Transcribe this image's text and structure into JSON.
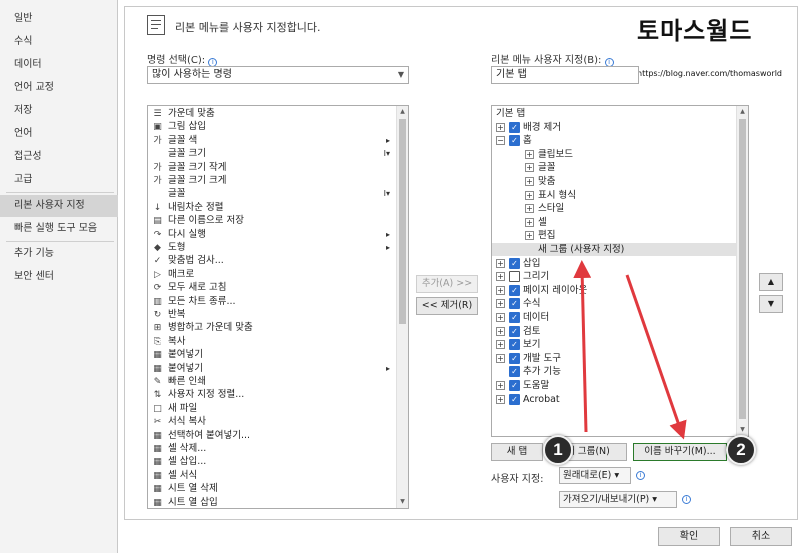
{
  "nav": {
    "items": [
      {
        "label": "일반"
      },
      {
        "label": "수식"
      },
      {
        "label": "데이터"
      },
      {
        "label": "언어 교정"
      },
      {
        "label": "저장"
      },
      {
        "label": "언어"
      },
      {
        "label": "접근성"
      },
      {
        "label": "고급"
      },
      {
        "label": "리본 사용자 지정"
      },
      {
        "label": "빠른 실행 도구 모음"
      },
      {
        "label": "추가 기능"
      },
      {
        "label": "보안 센터"
      }
    ],
    "selected": "리본 사용자 지정"
  },
  "header": {
    "title": "리본 메뉴를 사용자 지정합니다."
  },
  "watermark": {
    "title": "토마스월드",
    "url": "https://blog.naver.com/thomasworld"
  },
  "left": {
    "label": "명령 선택(C):",
    "combo_value": "많이 사용하는 명령",
    "commands": [
      {
        "icon": "☰",
        "label": "가운데 맞춤",
        "side": ""
      },
      {
        "icon": "▣",
        "label": "그림 삽입",
        "side": ""
      },
      {
        "icon": "가",
        "label": "글꼴 색",
        "side": "▸"
      },
      {
        "icon": "",
        "label": "글꼴 크기",
        "side": "I▾"
      },
      {
        "icon": "가",
        "label": "글꼴 크기 작게",
        "side": ""
      },
      {
        "icon": "가",
        "label": "글꼴 크기 크게",
        "side": ""
      },
      {
        "icon": "",
        "label": "글꼴",
        "side": "I▾"
      },
      {
        "icon": "↓",
        "label": "내림차순 정렬",
        "side": ""
      },
      {
        "icon": "▤",
        "label": "다른 이름으로 저장",
        "side": ""
      },
      {
        "icon": "↷",
        "label": "다시 실행",
        "side": "▸"
      },
      {
        "icon": "◆",
        "label": "도형",
        "side": "▸"
      },
      {
        "icon": "✓",
        "label": "맞춤법 검사...",
        "side": ""
      },
      {
        "icon": "▷",
        "label": "매크로",
        "side": ""
      },
      {
        "icon": "⟳",
        "label": "모두 새로 고침",
        "side": ""
      },
      {
        "icon": "▥",
        "label": "모든 차트 종류...",
        "side": ""
      },
      {
        "icon": "↻",
        "label": "반복",
        "side": ""
      },
      {
        "icon": "⊞",
        "label": "병합하고 가운데 맞춤",
        "side": ""
      },
      {
        "icon": "⎘",
        "label": "복사",
        "side": ""
      },
      {
        "icon": "▦",
        "label": "붙여넣기",
        "side": ""
      },
      {
        "icon": "▦",
        "label": "붙여넣기",
        "side": "▸"
      },
      {
        "icon": "✎",
        "label": "빠른 인쇄",
        "side": ""
      },
      {
        "icon": "⇅",
        "label": "사용자 지정 정렬...",
        "side": ""
      },
      {
        "icon": "□",
        "label": "새 파일",
        "side": ""
      },
      {
        "icon": "✂",
        "label": "서식 복사",
        "side": ""
      },
      {
        "icon": "▦",
        "label": "선택하여 붙여넣기...",
        "side": ""
      },
      {
        "icon": "▦",
        "label": "셀 삭제...",
        "side": ""
      },
      {
        "icon": "▦",
        "label": "셀 삽입...",
        "side": ""
      },
      {
        "icon": "▦",
        "label": "셀 서식",
        "side": ""
      },
      {
        "icon": "▦",
        "label": "시트 열 삭제",
        "side": ""
      },
      {
        "icon": "▦",
        "label": "시트 열 삽입",
        "side": ""
      }
    ]
  },
  "middle": {
    "add_button": "추가(A) >>",
    "remove_button": "<< 제거(R)"
  },
  "right": {
    "label": "리본 메뉴 사용자 지정(B):",
    "textbox_value": "기본 탭",
    "tree": [
      {
        "kind": "header",
        "label": "기본 탭"
      },
      {
        "kind": "tab",
        "expander": "⊞",
        "checked": true,
        "label": "배경 제거"
      },
      {
        "kind": "tab",
        "expander": "⊟",
        "checked": true,
        "label": "홈"
      },
      {
        "kind": "group",
        "expander": "⊞",
        "label": "클립보드"
      },
      {
        "kind": "group",
        "expander": "⊞",
        "label": "글꼴"
      },
      {
        "kind": "group",
        "expander": "⊞",
        "label": "맞춤"
      },
      {
        "kind": "group",
        "expander": "⊞",
        "label": "표시 형식"
      },
      {
        "kind": "group",
        "expander": "⊞",
        "label": "스타일"
      },
      {
        "kind": "group",
        "expander": "⊞",
        "label": "셀"
      },
      {
        "kind": "group",
        "expander": "⊞",
        "label": "편집"
      },
      {
        "kind": "newgroup",
        "label": "새 그룹 (사용자 지정)"
      },
      {
        "kind": "tab",
        "expander": "⊞",
        "checked": true,
        "label": "삽입"
      },
      {
        "kind": "tab",
        "expander": "⊞",
        "checked": false,
        "label": "그리기"
      },
      {
        "kind": "tab",
        "expander": "⊞",
        "checked": true,
        "label": "페이지 레이아웃"
      },
      {
        "kind": "tab",
        "expander": "⊞",
        "checked": true,
        "label": "수식"
      },
      {
        "kind": "tab",
        "expander": "⊞",
        "checked": true,
        "label": "데이터"
      },
      {
        "kind": "tab",
        "expander": "⊞",
        "checked": true,
        "label": "검토"
      },
      {
        "kind": "tab",
        "expander": "⊞",
        "checked": true,
        "label": "보기"
      },
      {
        "kind": "tab",
        "expander": "⊞",
        "checked": true,
        "label": "개발 도구"
      },
      {
        "kind": "tab",
        "expander": "",
        "checked": true,
        "label": "추가 기능"
      },
      {
        "kind": "tab",
        "expander": "⊞",
        "checked": true,
        "label": "도움말"
      },
      {
        "kind": "tab",
        "expander": "⊞",
        "checked": true,
        "label": "Acrobat"
      }
    ],
    "new_tab_button": "새 탭",
    "new_group_button": "새 그룹(N)",
    "rename_button": "이름 바꾸기(M)...",
    "customize_label": "사용자 지정:",
    "reset_combo": "원래대로(E) ▾",
    "import_export_combo": "가져오기/내보내기(P) ▾"
  },
  "annotations": {
    "badge1": "1",
    "badge2": "2",
    "arrow_color": "#e0393e"
  },
  "footer": {
    "ok": "확인",
    "cancel": "취소"
  }
}
